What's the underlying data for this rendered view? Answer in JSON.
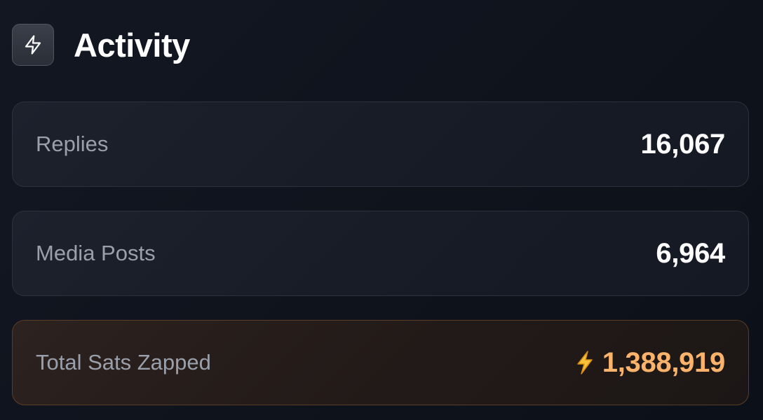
{
  "header": {
    "icon": "lightning-bolt-icon",
    "title": "Activity"
  },
  "stats": [
    {
      "label": "Replies",
      "value": "16,067"
    },
    {
      "label": "Media Posts",
      "value": "6,964"
    },
    {
      "label": "Total Sats Zapped",
      "value": "1,388,919",
      "icon": "lightning-emoji-icon"
    }
  ],
  "colors": {
    "background": "#10141d",
    "card_border": "#2c323d",
    "zap_border": "#5a3d28",
    "zap_value": "#fbb26a",
    "label": "#9aa0ab"
  }
}
